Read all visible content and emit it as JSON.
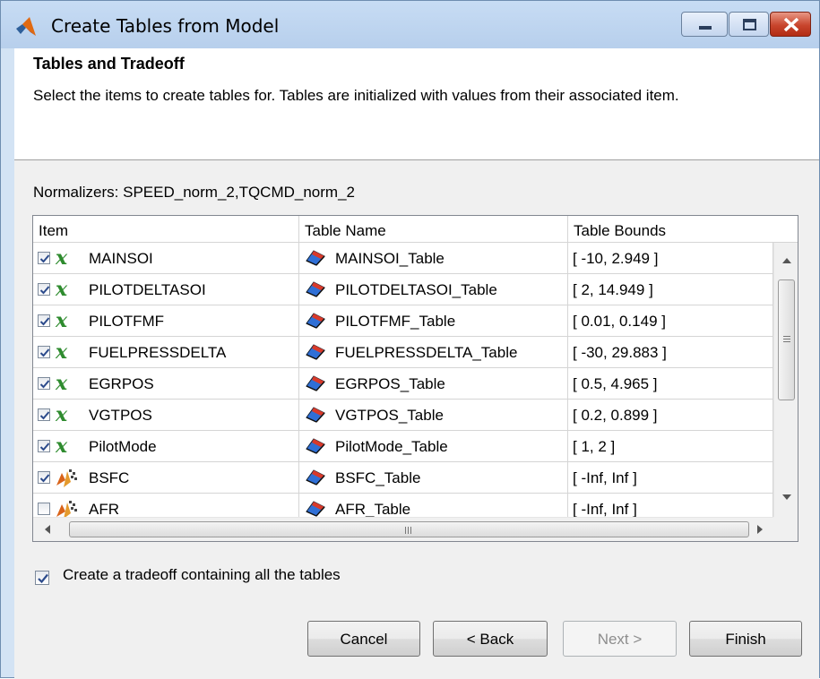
{
  "window": {
    "title": "Create Tables from Model",
    "controls": [
      "minimize",
      "maximize",
      "close"
    ]
  },
  "header": {
    "section_title": "Tables and Tradeoff",
    "description": "Select the items to create tables for. Tables are initialized with values from their associated item."
  },
  "normalizers": "Normalizers: SPEED_norm_2,TQCMD_norm_2",
  "table": {
    "columns": [
      "Item",
      "Table Name",
      "Table Bounds"
    ],
    "rows": [
      {
        "checked": true,
        "icon": "variable-x-icon",
        "item": "MAINSOI",
        "table_name": "MAINSOI_Table",
        "bounds": "[ -10, 2.949 ]"
      },
      {
        "checked": true,
        "icon": "variable-x-icon",
        "item": "PILOTDELTASOI",
        "table_name": "PILOTDELTASOI_Table",
        "bounds": "[ 2, 14.949 ]"
      },
      {
        "checked": true,
        "icon": "variable-x-icon",
        "item": "PILOTFMF",
        "table_name": "PILOTFMF_Table",
        "bounds": "[ 0.01, 0.149 ]"
      },
      {
        "checked": true,
        "icon": "variable-x-icon",
        "item": "FUELPRESSDELTA",
        "table_name": "FUELPRESSDELTA_Table",
        "bounds": "[ -30, 29.883 ]"
      },
      {
        "checked": true,
        "icon": "variable-x-icon",
        "item": "EGRPOS",
        "table_name": "EGRPOS_Table",
        "bounds": "[ 0.5, 4.965 ]"
      },
      {
        "checked": true,
        "icon": "variable-x-icon",
        "item": "VGTPOS",
        "table_name": "VGTPOS_Table",
        "bounds": "[ 0.2, 0.899 ]"
      },
      {
        "checked": true,
        "icon": "variable-x-icon",
        "item": "PilotMode",
        "table_name": "PilotMode_Table",
        "bounds": "[ 1, 2 ]"
      },
      {
        "checked": true,
        "icon": "model-icon",
        "item": "BSFC",
        "table_name": "BSFC_Table",
        "bounds": "[ -Inf, Inf ]"
      },
      {
        "checked": false,
        "icon": "model-icon",
        "item": "AFR",
        "table_name": "AFR_Table",
        "bounds": "[ -Inf, Inf ]"
      }
    ]
  },
  "tradeoff": {
    "checked": true,
    "label": "Create a tradeoff containing all the tables"
  },
  "buttons": {
    "cancel": "Cancel",
    "back": "< Back",
    "next": "Next >",
    "finish": "Finish"
  },
  "colors": {
    "title_bar": "#c7dcf4",
    "close_button": "#c8452d",
    "variable_icon": "#2e8b2e"
  }
}
